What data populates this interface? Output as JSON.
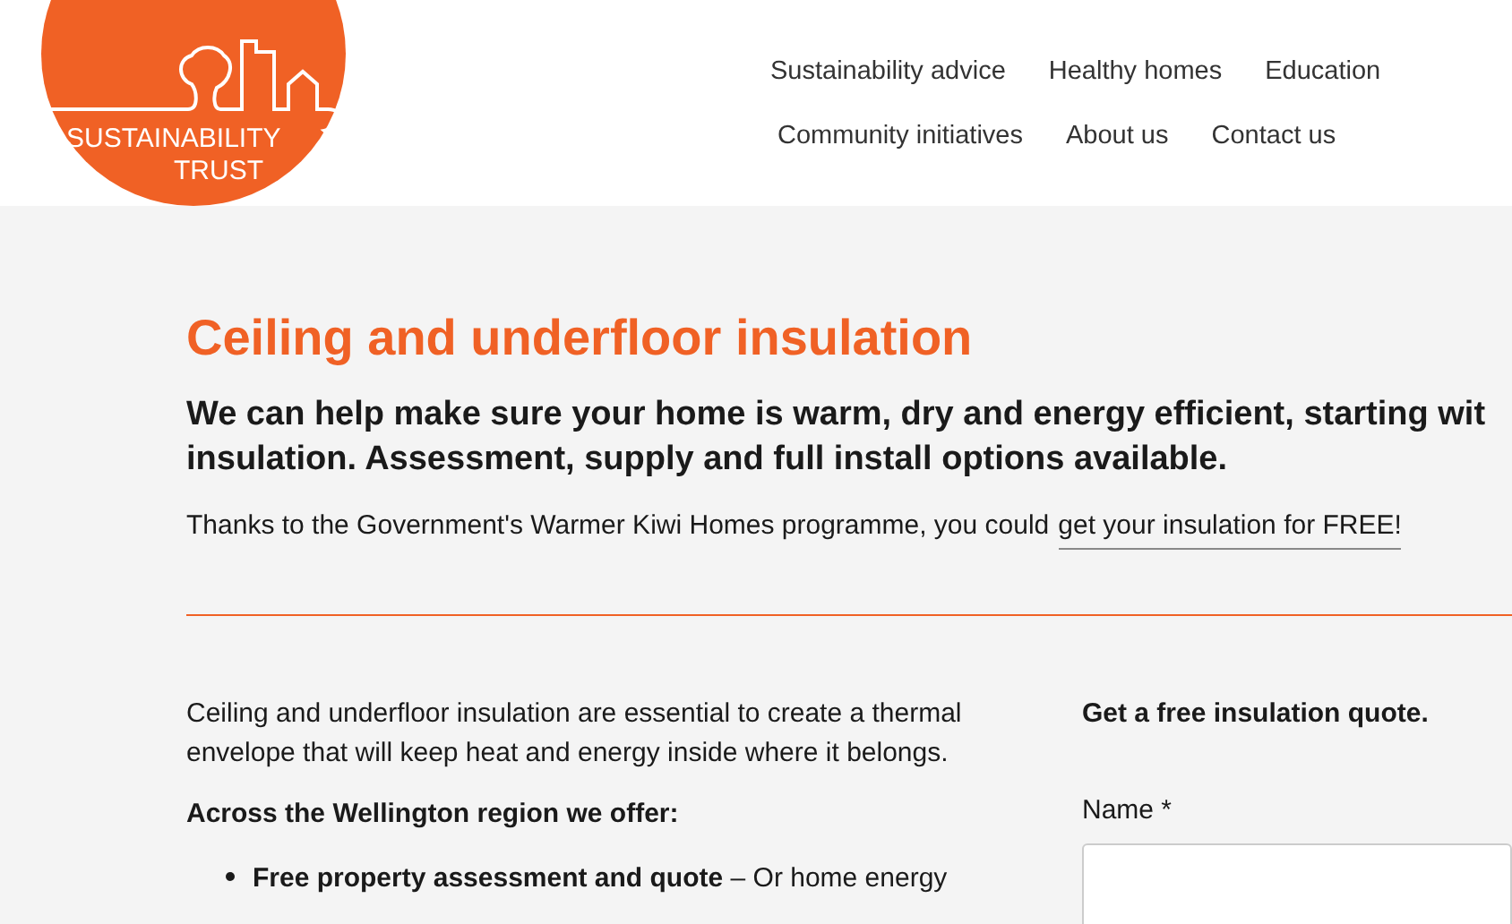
{
  "logo": {
    "line_1": "SUSTAINABILITY",
    "line_2": "TRUST"
  },
  "nav": {
    "rows": [
      [
        "Sustainability advice",
        "Healthy homes",
        "Education"
      ],
      [
        "Community initiatives",
        "About us",
        "Contact us"
      ]
    ]
  },
  "title": "Ceiling and underfloor insulation",
  "lead": [
    "We can help make sure your home is warm, dry and energy efficient, starting wit",
    "insulation. Assessment, supply and full install options available."
  ],
  "notice": {
    "text": "Thanks to the Government's Warmer Kiwi Homes programme, you could",
    "link": "get your insulation for FREE!"
  },
  "intro": "Ceiling and underfloor insulation are essential to create a thermal envelope that will keep heat and energy inside where it belongs.",
  "offer_heading": "Across the Wellington region we offer:",
  "offers": [
    "**Free property assessment and quote** – Or home energy"
  ],
  "form": {
    "heading": "Get a free insulation quote.",
    "fields": [
      {
        "label": "Name *"
      }
    ]
  }
}
